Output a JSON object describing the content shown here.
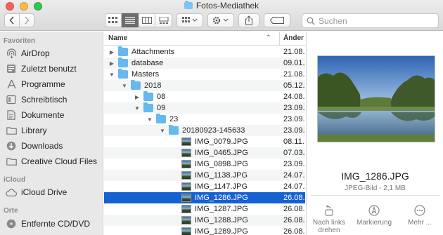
{
  "window": {
    "title": "Fotos-Mediathek"
  },
  "toolbar": {
    "back_icon": "chevron-left-icon",
    "forward_icon": "chevron-right-icon",
    "views": [
      "icon-view",
      "list-view",
      "column-view",
      "gallery-view"
    ],
    "active_view": "list-view",
    "search_placeholder": "Suchen"
  },
  "sidebar": {
    "sections": [
      {
        "title": "Favoriten",
        "items": [
          "AirDrop",
          "Zuletzt benutzt",
          "Programme",
          "Schreibtisch",
          "Dokumente",
          "Library",
          "Downloads",
          "Creative Cloud Files"
        ]
      },
      {
        "title": "iCloud",
        "items": [
          "iCloud Drive"
        ]
      },
      {
        "title": "Orte",
        "items": [
          "Entfernte CD/DVD"
        ]
      }
    ]
  },
  "list": {
    "columns": {
      "name": "Name",
      "date": "Änder"
    },
    "rows": [
      {
        "name": "Attachments",
        "date": "21.08.",
        "type": "folder",
        "depth": 0,
        "state": "collapsed"
      },
      {
        "name": "database",
        "date": "09.01.",
        "type": "folder",
        "depth": 0,
        "state": "collapsed"
      },
      {
        "name": "Masters",
        "date": "21.08.",
        "type": "folder",
        "depth": 0,
        "state": "expanded"
      },
      {
        "name": "2018",
        "date": "05.12.",
        "type": "folder",
        "depth": 1,
        "state": "expanded"
      },
      {
        "name": "08",
        "date": "24.08.",
        "type": "folder",
        "depth": 2,
        "state": "collapsed"
      },
      {
        "name": "09",
        "date": "23.09.",
        "type": "folder",
        "depth": 2,
        "state": "expanded"
      },
      {
        "name": "23",
        "date": "23.09.",
        "type": "folder",
        "depth": 3,
        "state": "expanded"
      },
      {
        "name": "20180923-145633",
        "date": "23.09.",
        "type": "folder",
        "depth": 4,
        "state": "expanded"
      },
      {
        "name": "IMG_0079.JPG",
        "date": "08.11.",
        "type": "image",
        "depth": 5
      },
      {
        "name": "IMG_0465.JPG",
        "date": "07.03.",
        "type": "image",
        "depth": 5
      },
      {
        "name": "IMG_0898.JPG",
        "date": "23.09.",
        "type": "image",
        "depth": 5
      },
      {
        "name": "IMG_1138.JPG",
        "date": "24.07.",
        "type": "image",
        "depth": 5
      },
      {
        "name": "IMG_1147.JPG",
        "date": "24.07.",
        "type": "image",
        "depth": 5
      },
      {
        "name": "IMG_1286.JPG",
        "date": "26.08.",
        "type": "image",
        "depth": 5,
        "selected": true
      },
      {
        "name": "IMG_1287.JPG",
        "date": "26.08.",
        "type": "image",
        "depth": 5
      },
      {
        "name": "IMG_1288.JPG",
        "date": "26.08.",
        "type": "image",
        "depth": 5
      },
      {
        "name": "IMG_1289.JPG",
        "date": "26.08.",
        "type": "image",
        "depth": 5
      }
    ]
  },
  "preview": {
    "file_name": "IMG_1286.JPG",
    "file_info": "JPEG-Bild - 2,1 MB",
    "actions": [
      {
        "label": "Nach links drehen",
        "icon": "rotate-left-icon"
      },
      {
        "label": "Markierung",
        "icon": "markup-icon"
      },
      {
        "label": "Mehr ...",
        "icon": "more-icon"
      }
    ]
  }
}
